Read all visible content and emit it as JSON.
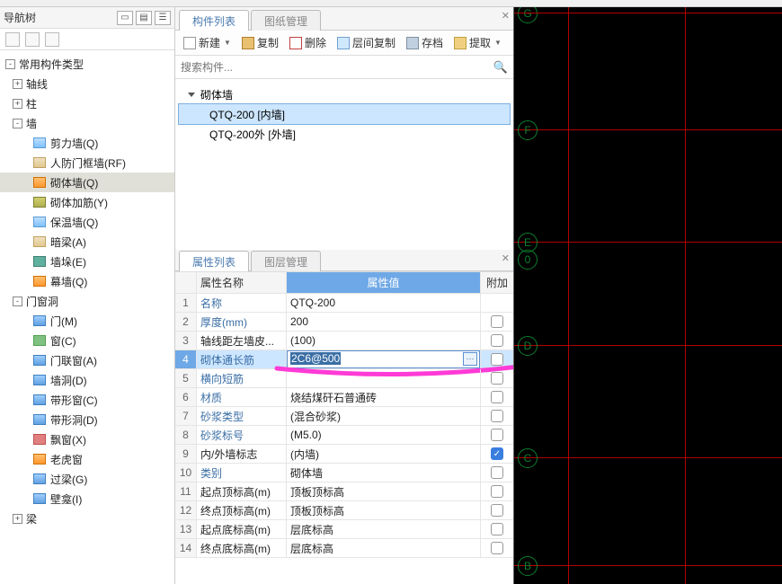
{
  "nav": {
    "title": "导航树",
    "root": "常用构件类型",
    "groups": [
      {
        "label": "轴线",
        "exp": "+"
      },
      {
        "label": "柱",
        "exp": "+"
      },
      {
        "label": "墙",
        "exp": "-",
        "children": [
          {
            "label": "剪力墙(Q)",
            "icon": "ic-blue"
          },
          {
            "label": "人防门框墙(RF)",
            "icon": "ic-tan"
          },
          {
            "label": "砌体墙(Q)",
            "icon": "ic-orange",
            "sel": true
          },
          {
            "label": "砌体加筋(Y)",
            "icon": "ic-olive"
          },
          {
            "label": "保温墙(Q)",
            "icon": "ic-blue"
          },
          {
            "label": "暗梁(A)",
            "icon": "ic-tan"
          },
          {
            "label": "墙垛(E)",
            "icon": "ic-teal"
          },
          {
            "label": "幕墙(Q)",
            "icon": "ic-orange"
          }
        ]
      },
      {
        "label": "门窗洞",
        "exp": "-",
        "children": [
          {
            "label": "门(M)",
            "icon": "ic-bluei"
          },
          {
            "label": "窗(C)",
            "icon": "ic-green"
          },
          {
            "label": "门联窗(A)",
            "icon": "ic-bluei"
          },
          {
            "label": "墙洞(D)",
            "icon": "ic-bluei"
          },
          {
            "label": "带形窗(C)",
            "icon": "ic-bluei"
          },
          {
            "label": "带形洞(D)",
            "icon": "ic-bluei"
          },
          {
            "label": "飘窗(X)",
            "icon": "ic-red"
          },
          {
            "label": "老虎窗",
            "icon": "ic-orange"
          },
          {
            "label": "过梁(G)",
            "icon": "ic-bluei"
          },
          {
            "label": "壁龛(I)",
            "icon": "ic-bluei"
          }
        ]
      },
      {
        "label": "梁",
        "exp": "+"
      }
    ]
  },
  "comp": {
    "tabs": [
      "构件列表",
      "图纸管理"
    ],
    "toolbar": {
      "new": "新建",
      "copy": "复制",
      "delete": "删除",
      "layercopy": "层间复制",
      "archive": "存档",
      "extract": "提取"
    },
    "search_placeholder": "搜索构件...",
    "tree_root": "砌体墙",
    "items": [
      {
        "label": "QTQ-200 [内墙]",
        "sel": true
      },
      {
        "label": "QTQ-200外 [外墙]"
      }
    ]
  },
  "props": {
    "tabs": [
      "属性列表",
      "图层管理"
    ],
    "head": {
      "name": "属性名称",
      "val": "属性值",
      "att": "附加"
    },
    "rows": [
      {
        "idx": 1,
        "name": "名称",
        "val": "QTQ-200",
        "link": true,
        "chk": null
      },
      {
        "idx": 2,
        "name": "厚度(mm)",
        "val": "200",
        "link": true,
        "chk": false
      },
      {
        "idx": 3,
        "name": "轴线距左墙皮...",
        "val": "(100)",
        "link": false,
        "chk": false
      },
      {
        "idx": 4,
        "name": "砌体通长筋",
        "val": "2C6@500",
        "link": true,
        "chk": false,
        "sel": true
      },
      {
        "idx": 5,
        "name": "横向短筋",
        "val": "",
        "link": true,
        "chk": false
      },
      {
        "idx": 6,
        "name": "材质",
        "val": "烧结煤矸石普通砖",
        "link": true,
        "chk": false
      },
      {
        "idx": 7,
        "name": "砂浆类型",
        "val": "(混合砂浆)",
        "link": true,
        "chk": false
      },
      {
        "idx": 8,
        "name": "砂浆标号",
        "val": "(M5.0)",
        "link": true,
        "chk": false
      },
      {
        "idx": 9,
        "name": "内/外墙标志",
        "val": "(内墙)",
        "link": false,
        "chk": true
      },
      {
        "idx": 10,
        "name": "类别",
        "val": "砌体墙",
        "link": true,
        "chk": false
      },
      {
        "idx": 11,
        "name": "起点顶标高(m)",
        "val": "顶板顶标高",
        "link": false,
        "chk": false
      },
      {
        "idx": 12,
        "name": "终点顶标高(m)",
        "val": "顶板顶标高",
        "link": false,
        "chk": false
      },
      {
        "idx": 13,
        "name": "起点底标高(m)",
        "val": "层底标高",
        "link": false,
        "chk": false
      },
      {
        "idx": 14,
        "name": "终点底标高(m)",
        "val": "层底标高",
        "link": false,
        "chk": false
      }
    ]
  },
  "cad": {
    "axis_labels": [
      "G",
      "F",
      "E",
      "D",
      "C",
      "B"
    ],
    "axis0": "0"
  }
}
